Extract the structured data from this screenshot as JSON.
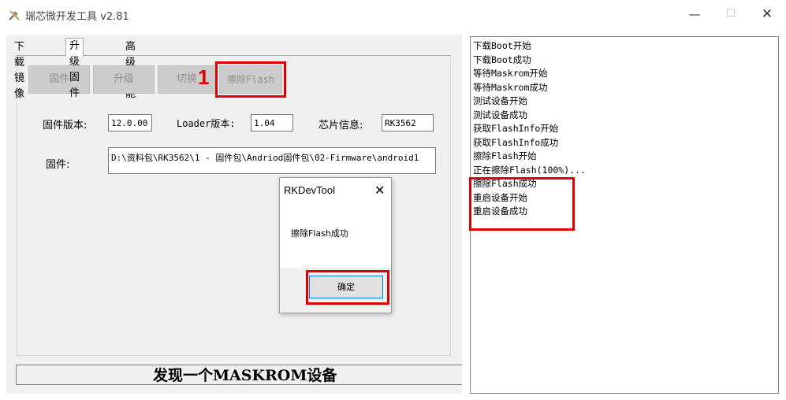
{
  "window": {
    "title": "瑞芯微开发工具 v2.81",
    "minimize": "—",
    "maximize": "☐",
    "close": "✕"
  },
  "tabs": [
    "下载镜像",
    "升级固件",
    "高级功能"
  ],
  "toolbar": {
    "firmware": "固件",
    "upgrade": "升级",
    "switch": "切换",
    "erase_flash": "擦除Flash",
    "step_marker": "1"
  },
  "info": {
    "fw_version_label": "固件版本:",
    "fw_version": "12.0.00",
    "loader_version_label": "Loader版本:",
    "loader_version": "1.04",
    "chip_label": "芯片信息:",
    "chip": "RK3562",
    "firmware_label": "固件:",
    "firmware_path": "D:\\资料包\\RK3562\\1 - 固件包\\Andriod固件包\\02-Firmware\\android1"
  },
  "dialog": {
    "title": "RKDevTool",
    "close": "✕",
    "message": "擦除Flash成功",
    "ok": "确定"
  },
  "status": "发现一个MASKROM设备",
  "log": [
    "下载Boot开始",
    "下载Boot成功",
    "等待Maskrom开始",
    "等待Maskrom成功",
    "测试设备开始",
    "测试设备成功",
    "获取FlashInfo开始",
    "获取FlashInfo成功",
    "擦除Flash开始",
    "正在擦除Flash(100%)...",
    "擦除Flash成功",
    "重启设备开始",
    "重启设备成功"
  ],
  "colors": {
    "highlight": "#e00000",
    "disabled_button": "#cccccc",
    "window_bg": "#f0f0f0"
  }
}
